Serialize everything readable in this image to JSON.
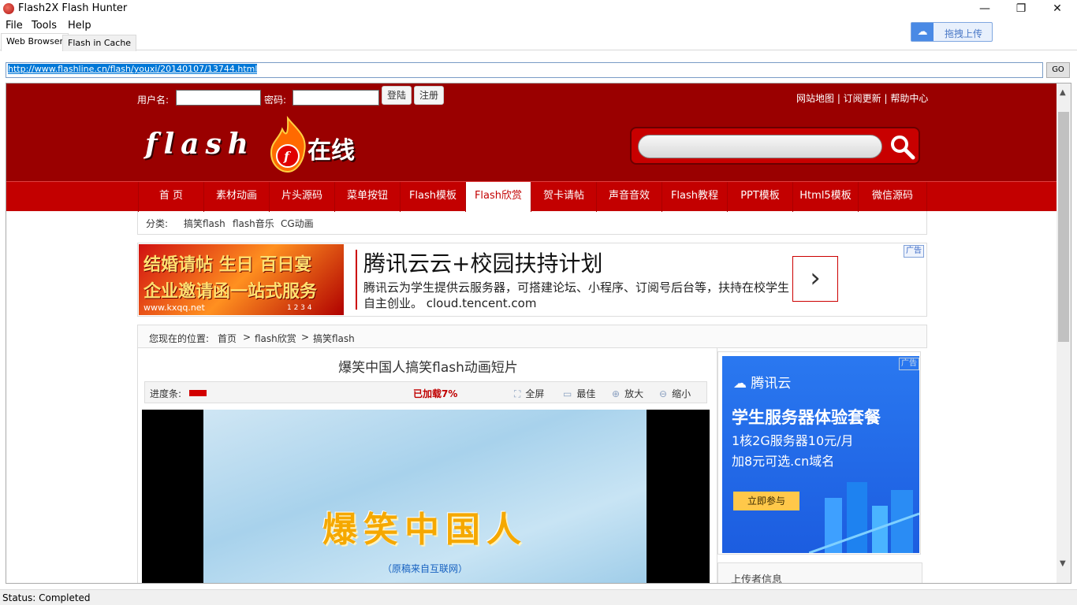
{
  "window": {
    "title": "Flash2X Flash Hunter",
    "minimize": "—",
    "restore": "❐",
    "close": "✕"
  },
  "menu": [
    "File",
    "Tools",
    "Help"
  ],
  "upload_widget": {
    "label": "拖拽上传",
    "icon": "baidu-cloud-icon"
  },
  "tabs": [
    {
      "label": "Web Browser",
      "active": true
    },
    {
      "label": "Flash in Cache",
      "active": false
    }
  ],
  "address": {
    "url": "http://www.flashline.cn/flash/youxi/20140107/13744.html",
    "go_label": "GO"
  },
  "site": {
    "login": {
      "username_label": "用户名:",
      "password_label": "密码:",
      "login_button": "登陆",
      "register_button": "注册"
    },
    "top_links": "网站地图 | 订阅更新 | 帮助中心",
    "logo_text": "flash",
    "logo_cn": "在线",
    "nav": [
      "首 页",
      "素材动画",
      "片头源码",
      "菜单按钮",
      "Flash模板",
      "Flash欣赏",
      "贺卡请帖",
      "声音音效",
      "Flash教程",
      "PPT模板",
      "Html5模板",
      "微信源码"
    ],
    "nav_active_index": 5,
    "category": {
      "label": "分类:",
      "items": [
        "搞笑flash",
        "flash音乐",
        "CG动画"
      ]
    },
    "ad": {
      "banner_line1": "结婚请帖 生日 百日宴",
      "banner_line2": "企业邀请函一站式服务",
      "banner_url": "www.kxqq.net",
      "banner_pages": "1 2 3 4",
      "title": "腾讯云云+校园扶持计划",
      "desc": "腾讯云为学生提供云服务器，可搭建论坛、小程序、订阅号后台等，扶持在校学生自主创业。 cloud.tencent.com",
      "arrow": "›",
      "badge": "广告"
    },
    "breadcrumb": {
      "label": "您现在的位置:",
      "items": [
        "首页",
        "flash欣赏",
        "搞笑flash"
      ],
      "separator": ">"
    },
    "player": {
      "title": "爆笑中国人搞笑flash动画短片",
      "progress_label": "进度条:",
      "progress": 0.07,
      "loaded_text": "已加载7%",
      "controls": [
        "全屏",
        "最佳",
        "放大",
        "缩小"
      ],
      "movie_heading": "爆笑中国人",
      "movie_sub": "（原稿来自互联网）"
    },
    "side_ad": {
      "logo": "腾讯云",
      "title": "学生服务器体验套餐",
      "line1": "1核2G服务器10元/月",
      "line2": "加8元可选.cn域名",
      "button": "立即参与",
      "badge": "广告"
    },
    "uploader_title": "上传者信息"
  },
  "status": "Status: Completed"
}
